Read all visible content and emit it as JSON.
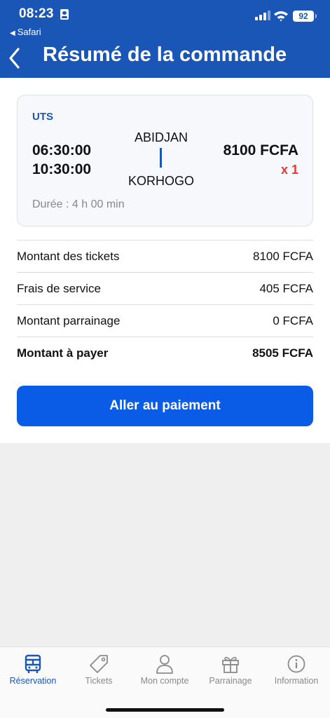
{
  "status_bar": {
    "time": "08:23",
    "back_app": "Safari",
    "battery": "92"
  },
  "header": {
    "title": "Résumé de la commande"
  },
  "trip": {
    "company": "UTS",
    "departure_time": "06:30:00",
    "arrival_time": "10:30:00",
    "from": "ABIDJAN",
    "to": "KORHOGO",
    "price": "8100 FCFA",
    "quantity": "x 1",
    "duration": "Durée : 4 h 00 min"
  },
  "summary": [
    {
      "label": "Montant des tickets",
      "value": "8100 FCFA"
    },
    {
      "label": "Frais de service",
      "value": "405 FCFA"
    },
    {
      "label": "Montant parrainage",
      "value": "0 FCFA"
    },
    {
      "label": "Montant à payer",
      "value": "8505 FCFA"
    }
  ],
  "pay_button": "Aller au paiement",
  "tabs": [
    {
      "label": "Réservation",
      "icon": "bus-icon"
    },
    {
      "label": "Tickets",
      "icon": "tag-icon"
    },
    {
      "label": "Mon compte",
      "icon": "user-icon"
    },
    {
      "label": "Parrainage",
      "icon": "gift-icon"
    },
    {
      "label": "Information",
      "icon": "info-icon"
    }
  ],
  "colors": {
    "primary": "#1a56b5",
    "button": "#0a5ce6",
    "quantity": "#e53935"
  }
}
